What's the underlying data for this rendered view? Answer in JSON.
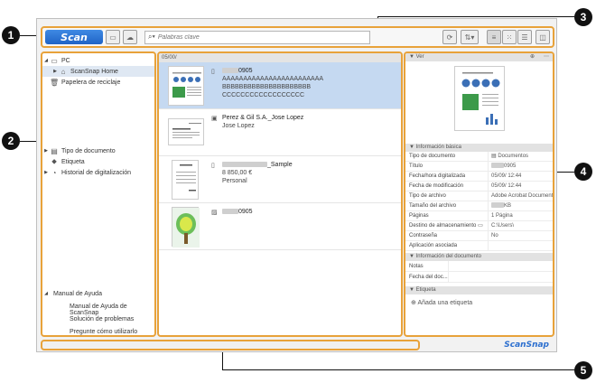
{
  "callouts": [
    "1",
    "2",
    "3",
    "4",
    "5"
  ],
  "toolbar": {
    "scan_label": "Scan",
    "search_placeholder": "Palabras clave",
    "icons": [
      "scanner-icon",
      "cloud-icon",
      "search-icon",
      "refresh-icon",
      "sort-icon",
      "list-view-icon",
      "thumbnail-view-icon",
      "detail-view-icon",
      "panel-toggle-icon"
    ]
  },
  "left_panel": {
    "pc_label": "PC",
    "scansnap_home_label": "ScanSnap Home",
    "trash_label": "Papelera de reciclaje",
    "doc_type_label": "Tipo de documento",
    "tag_label": "Etiqueta",
    "history_label": "Historial de digitalización",
    "help": {
      "title": "Manual de Ayuda",
      "items": [
        "Manual de Ayuda de ScanSnap",
        "Solución de problemas",
        "Pregunte cómo utilizarlo"
      ]
    }
  },
  "list": {
    "date_header": "05/00/",
    "documents": [
      {
        "title": "0905",
        "line1": "AAAAAAAAAAAAAAAAAAAAAAAA",
        "line2": "BBBBBBBBBBBBBBBBBBBBB",
        "line3": "CCCCCCCCCCCCCCCCCC"
      },
      {
        "title": "Perez & Gil S.A._Jose Lopez",
        "line1": "Jose Lopez",
        "line2": "",
        "line3": ""
      },
      {
        "title": "_Sample",
        "line1": "8 850,00 €",
        "line2": "Personal",
        "line3": ""
      },
      {
        "title": "0905",
        "line1": "",
        "line2": "",
        "line3": ""
      }
    ]
  },
  "right_panel": {
    "preview_label": "Ver",
    "basic_info_label": "Información básica",
    "rows": [
      {
        "key": "Tipo de documento",
        "value": "Documentos"
      },
      {
        "key": "Título",
        "value": "0905"
      },
      {
        "key": "Fecha/hora digitalizada",
        "value": "05/09/      12:44"
      },
      {
        "key": "Fecha de modificación",
        "value": "05/09/      12:44"
      },
      {
        "key": "Tipo de archivo",
        "value": "Adobe Acrobat Document"
      },
      {
        "key": "Tamaño del archivo",
        "value": "KB"
      },
      {
        "key": "Páginas",
        "value": "1 Página"
      },
      {
        "key": "Destino de almacenamiento",
        "value": "C:\\Users\\"
      },
      {
        "key": "Contraseña",
        "value": "No"
      },
      {
        "key": "Aplicación asociada",
        "value": ""
      }
    ],
    "doc_info_label": "Información del documento",
    "notes_label": "Notas",
    "doc_date_label": "Fecha del doc...",
    "tag_section_label": "Etiqueta",
    "add_tag_label": "Añada una etiqueta"
  },
  "status_bar": {
    "brand": "ScanSnap"
  }
}
